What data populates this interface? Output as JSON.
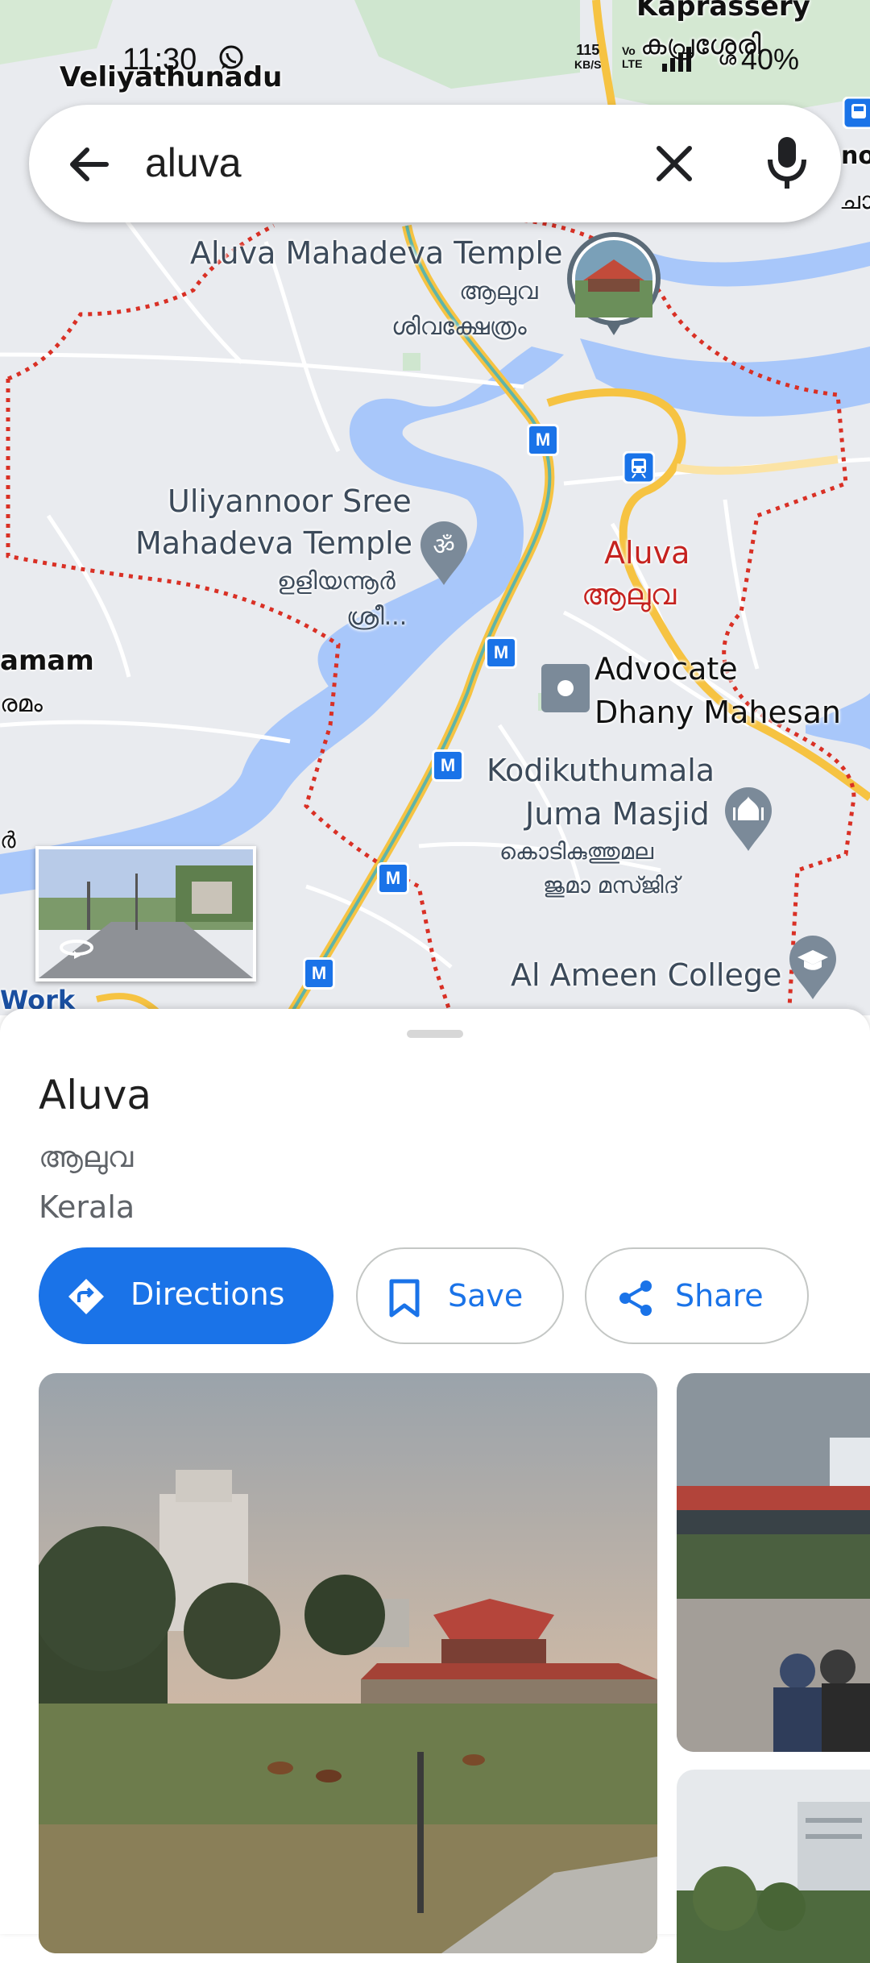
{
  "status_bar": {
    "time": "11:30",
    "speed_value": "115",
    "speed_unit": "KB/S",
    "volte_top": "Vo",
    "volte_bottom": "LTE",
    "battery": "40%"
  },
  "search": {
    "query": "aluva"
  },
  "map": {
    "labels": {
      "veliyathunadu": "Veliyathunadu",
      "kaprassery": "Kaprassery",
      "kaprassery_local": "കപ്രശ്ശേരി",
      "right_edge_top": "no",
      "right_edge_local": "ചാ",
      "left_edge_name": "amam",
      "left_edge_local": "രമം",
      "left_edge_small": "ർ",
      "work": "Work",
      "temple_name": "Aluva Mahadeva Temple",
      "temple_local_1": "ആലുവ",
      "temple_local_2": "ശിവക്ഷേത്രം",
      "uliyannoor_1": "Uliyannoor Sree",
      "uliyannoor_2": "Mahadeva Temple",
      "uliyannoor_local_1": "ഉളിയന്നൂർ",
      "uliyannoor_local_2": "ശ്രീ...",
      "aluva": "Aluva",
      "aluva_local": "ആലുവ",
      "advocate_1": "Advocate",
      "advocate_2": "Dhany Mahesan",
      "masjid_1": "Kodikuthumala",
      "masjid_2": "Juma Masjid",
      "masjid_local_1": "കൊടികുത്തുമല",
      "masjid_local_2": "ജുമാ മസ്ജിദ്",
      "college": "Al Ameen College",
      "metro_letter": "M"
    }
  },
  "place": {
    "name": "Aluva",
    "local_name": "ആലുവ",
    "region": "Kerala"
  },
  "actions": {
    "directions": "Directions",
    "save": "Save",
    "share": "Share"
  },
  "colors": {
    "accent": "#1a73e8",
    "boundary": "#d93025",
    "river": "#a8c7fa",
    "highway": "#f6c342"
  }
}
